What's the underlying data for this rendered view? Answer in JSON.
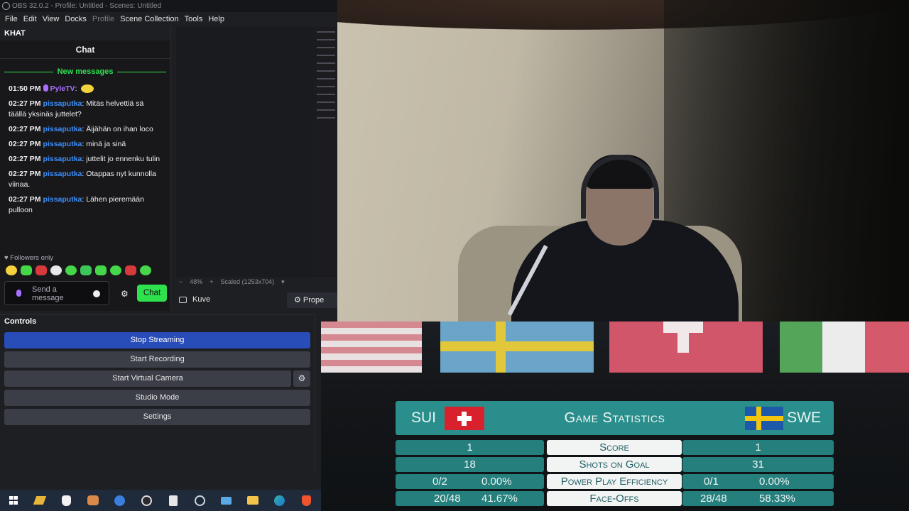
{
  "obs": {
    "window_title": "OBS 32.0.2 - Profile: Untitled - Scenes: Untitled",
    "menu": [
      "File",
      "Edit",
      "View",
      "Docks",
      "Profile",
      "Scene Collection",
      "Tools",
      "Help"
    ],
    "chat_dock": {
      "title": "KHAT",
      "header": "Chat",
      "new_messages": "New messages",
      "messages": [
        {
          "time": "01:50 PM",
          "user": "PyleTV",
          "text": ":",
          "color": "#a970ff"
        },
        {
          "time": "02:27 PM",
          "user": "pissaputka",
          "text": ": Mitäs helvettiä sä täällä yksinäs juttelet?",
          "color": "#3d8ef8"
        },
        {
          "time": "02:27 PM",
          "user": "pissaputka",
          "text": ": Äijähän on ihan loco",
          "color": "#3d8ef8"
        },
        {
          "time": "02:27 PM",
          "user": "pissaputka",
          "text": ": minä ja sinä",
          "color": "#3d8ef8"
        },
        {
          "time": "02:27 PM",
          "user": "pissaputka",
          "text": ": juttelit jo ennenku tulin",
          "color": "#3d8ef8"
        },
        {
          "time": "02:27 PM",
          "user": "pissaputka",
          "text": ": Otappas nyt kunnolla viinaa.",
          "color": "#3d8ef8"
        },
        {
          "time": "02:27 PM",
          "user": "pissaputka",
          "text": ": Lähen pieremään pulloon",
          "color": "#3d8ef8"
        }
      ],
      "followers_only": "Followers only",
      "input_placeholder": "Send a message",
      "chat_button": "Chat"
    },
    "preview": {
      "zoom_minus": "−",
      "zoom": "48%",
      "zoom_plus": "+",
      "scale": "Scaled (1253x704)"
    },
    "source": {
      "name": "Kuve",
      "properties": "Prope"
    },
    "controls": {
      "title": "Controls",
      "buttons": [
        "Stop Streaming",
        "Start Recording",
        "Start Virtual Camera",
        "Studio Mode",
        "Settings"
      ]
    }
  },
  "broadcast": {
    "team_left": "SUI",
    "team_right": "SWE",
    "title": "Game Statistics",
    "stats": [
      {
        "label": "Score",
        "left": "1",
        "right": "1"
      },
      {
        "label": "Shots on Goal",
        "left": "18",
        "right": "31"
      },
      {
        "label": "Power Play Efficiency",
        "left_a": "0/2",
        "left_b": "0.00%",
        "right_a": "0/1",
        "right_b": "0.00%"
      },
      {
        "label": "Face-Offs",
        "left_a": "20/48",
        "left_b": "41.67%",
        "right_a": "28/48",
        "right_b": "58.33%"
      }
    ]
  },
  "colors": {
    "obs_bg": "#1e1f23",
    "chat_bg": "#18181b",
    "twitch_green": "#2ee24e",
    "stream_active": "#284cb8",
    "stats_teal": "#2a8f8c"
  },
  "taskbar": {
    "icons": [
      "windows-start-icon",
      "winamp-icon",
      "wolf-icon",
      "game-icon",
      "blue-app-icon",
      "obs-icon",
      "box-icon",
      "steam-icon",
      "mail-icon",
      "file-explorer-icon",
      "edge-icon",
      "brave-icon"
    ]
  }
}
